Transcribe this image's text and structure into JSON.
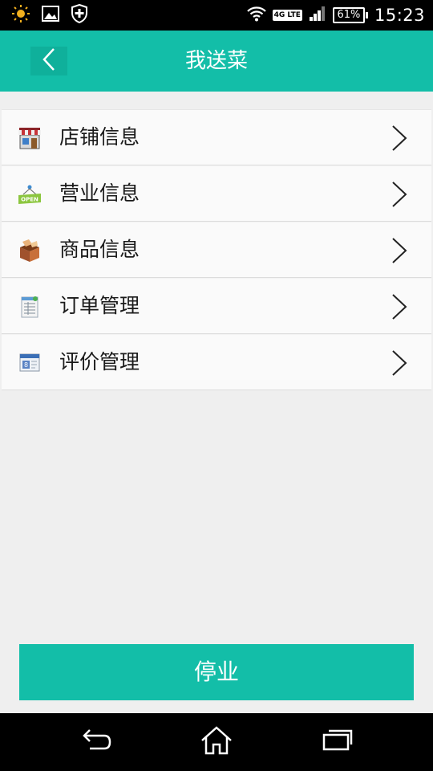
{
  "status_bar": {
    "network_label": "4G LTE",
    "battery_text": "61%",
    "time": "15:23",
    "icons": [
      "sun-icon",
      "image-icon",
      "shield-plus-icon",
      "wifi-icon",
      "signal-icon",
      "battery-icon"
    ]
  },
  "header": {
    "title": "我送菜",
    "back_icon": "chevron-left-icon"
  },
  "menu": {
    "items": [
      {
        "label": "店铺信息",
        "icon": "storefront-icon"
      },
      {
        "label": "营业信息",
        "icon": "open-sign-icon"
      },
      {
        "label": "商品信息",
        "icon": "product-box-icon"
      },
      {
        "label": "订单管理",
        "icon": "order-sheet-icon"
      },
      {
        "label": "评价管理",
        "icon": "review-window-icon"
      }
    ]
  },
  "actions": {
    "stop_label": "停业"
  },
  "colors": {
    "accent": "#13bea8",
    "background": "#efefef",
    "row_background": "#fafafa"
  },
  "nav_bar": {
    "icons": [
      "back-icon",
      "home-icon",
      "recent-apps-icon"
    ]
  }
}
